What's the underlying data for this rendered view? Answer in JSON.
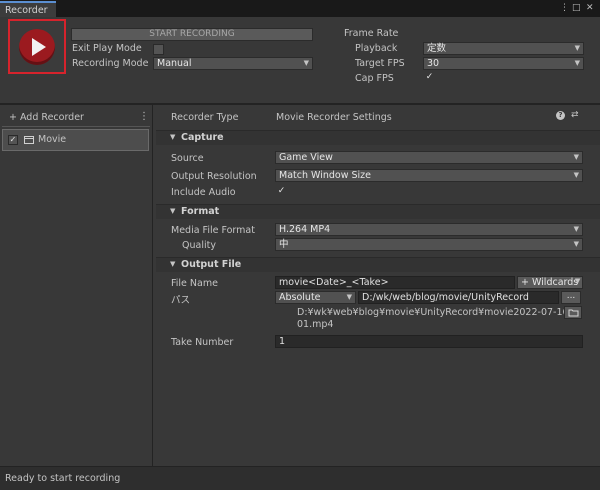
{
  "window": {
    "tab_title": "Recorder",
    "menu_icon": "kebab-icon",
    "maximize_icon": "maximize-icon",
    "close_icon": "close-icon"
  },
  "top": {
    "start_recording_label": "START RECORDING",
    "exit_play_mode_label": "Exit Play Mode",
    "exit_play_mode_checked": false,
    "recording_mode_label": "Recording Mode",
    "recording_mode_value": "Manual",
    "frame_rate_label": "Frame Rate",
    "playback_label": "Playback",
    "playback_value": "定数",
    "target_fps_label": "Target FPS",
    "target_fps_value": "30",
    "cap_fps_label": "Cap FPS",
    "cap_fps_checked": true
  },
  "sidebar": {
    "add_recorder_label": "+ Add Recorder",
    "recorders": [
      {
        "label": "Movie",
        "checked": true
      }
    ]
  },
  "settings": {
    "recorder_type_label": "Recorder Type",
    "recorder_type_value": "Movie Recorder Settings",
    "capture": {
      "title": "Capture",
      "source_label": "Source",
      "source_value": "Game View",
      "output_resolution_label": "Output Resolution",
      "output_resolution_value": "Match Window Size",
      "include_audio_label": "Include Audio",
      "include_audio_checked": true
    },
    "format": {
      "title": "Format",
      "media_file_format_label": "Media File Format",
      "media_file_format_value": "H.264 MP4",
      "quality_label": "Quality",
      "quality_value": "中"
    },
    "output_file": {
      "title": "Output File",
      "file_name_label": "File Name",
      "file_name_value": "movie<Date>_<Take>",
      "wildcards_label": "+ Wildcards",
      "path_label": "パス",
      "path_type_value": "Absolute",
      "path_value": "D:/wk/web/blog/movie/UnityRecord",
      "path_browse_label": "...",
      "full_path_line1": "D:¥wk¥web¥blog¥movie¥UnityRecord¥movie2022-07-16_0",
      "full_path_line2": "01.mp4",
      "take_number_label": "Take Number",
      "take_number_value": "1"
    }
  },
  "status": {
    "text": "Ready to start recording"
  }
}
